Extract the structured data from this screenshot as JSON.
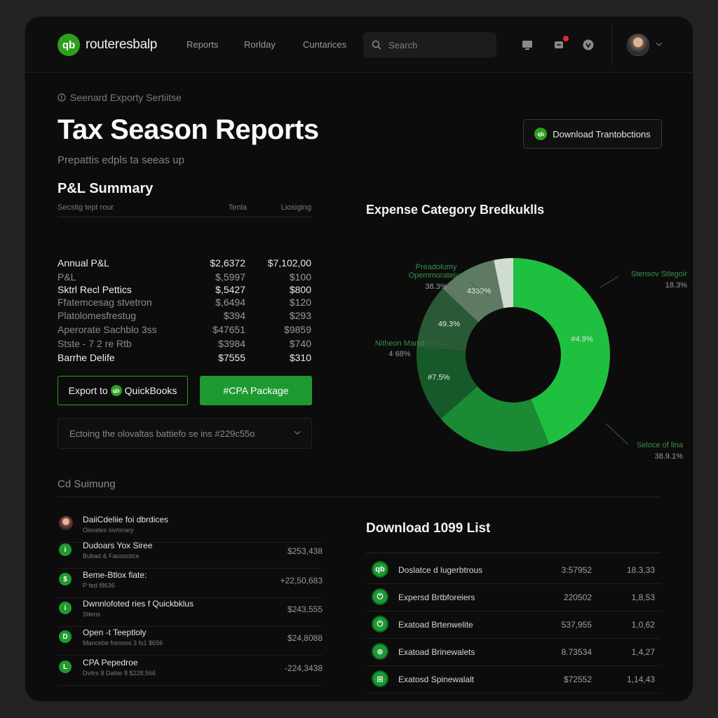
{
  "app": {
    "logo_text": "routeresbalp",
    "logo_mark": "qb",
    "nav": [
      "Reports",
      "Rorlday",
      "Cuntarices"
    ],
    "search_placeholder": "Search"
  },
  "header": {
    "breadcrumb": "Seenard Exporty Sertiitse",
    "title": "Tax Season Reports",
    "subtitle": "Prepattis edpls ta seeas up",
    "download_button": "Download Trantobctions"
  },
  "pl": {
    "title": "P&L Summary",
    "columns": [
      "Secstig tept rour",
      "Tenla",
      "Liosiging"
    ],
    "rows": [
      {
        "label": "Annual P&L",
        "v1": "$2,6372",
        "v2": "$7,102,00",
        "strong": true
      },
      {
        "label": "P&L",
        "v1": "$,5997",
        "v2": "$100",
        "strong": false
      },
      {
        "label": "Sktrl Recl Pettics",
        "v1": "$,5427",
        "v2": "$800",
        "strong": true
      },
      {
        "label": "Ffatemcesag stvetron",
        "v1": "$,6494",
        "v2": "$120",
        "strong": false
      },
      {
        "label": "Platolomesfrestug",
        "v1": "$394",
        "v2": "$293",
        "strong": false
      },
      {
        "label": "Aperorate Sachblo 3ss",
        "v1": "$47651",
        "v2": "$9859",
        "strong": false
      },
      {
        "label": "Stste - 7 2 re Rtb",
        "v1": "$3984",
        "v2": "$740",
        "strong": false
      },
      {
        "label": "Barrhe Delife",
        "v1": "$7555",
        "v2": "$310",
        "strong": true
      }
    ],
    "export_label": "Export to",
    "export_brand": "QuickBooks",
    "cpa_label": "#CPA Package",
    "dropdown_text": "Ectoing the olovaltas battiefo se ins #229c55o"
  },
  "chart_data": {
    "type": "pie",
    "title": "Expense Category Bredkuklls",
    "donut": true,
    "slices": [
      {
        "label": "",
        "value": 44.9,
        "pct_text": "#4.9%",
        "color": "#1fbf40"
      },
      {
        "label": "",
        "value": 20.0,
        "pct_text": "",
        "color": "#1b8a35"
      },
      {
        "label": "",
        "value": 13.0,
        "pct_text": "#7.5%",
        "color": "#175a2a"
      },
      {
        "label": "",
        "value": 11.0,
        "pct_text": "49.3%",
        "color": "#2a5a35"
      },
      {
        "label": "",
        "value": 10.0,
        "pct_text": "4339%",
        "color": "#5e7a62"
      },
      {
        "label": "",
        "value": 3.3,
        "pct_text": "",
        "color": "#d0dccf"
      }
    ],
    "callouts": [
      {
        "name": "Preadolumy",
        "sub": "Opemmorateiue",
        "pct": "38.3%"
      },
      {
        "name": "Stensov Stlegoir",
        "sub": "",
        "pct": "18.3%"
      },
      {
        "name": "Nitheon Mansl",
        "sub": "",
        "pct": "4 68%"
      },
      {
        "name": "Seloce of lina",
        "sub": "",
        "pct": "38.9.1%"
      }
    ]
  },
  "ca": {
    "title": "Cd Suimung",
    "items": [
      {
        "name": "DaiiCdeliie foi dbrdices",
        "sub": "Oiorates sivmnary",
        "amount": "",
        "icon": "avatar"
      },
      {
        "name": "Dudoars Yox Siree",
        "sub": "Bubad & Facooctice",
        "amount": "$253,438",
        "icon": "i"
      },
      {
        "name": "Beme-Btlox fiate:",
        "sub": "P fed f8636",
        "amount": "+22,50,683",
        "icon": "$"
      },
      {
        "name": "Dwnnlofoted ries f Quickbklus",
        "sub": "Stiens",
        "amount": "$243,555",
        "icon": "i"
      },
      {
        "name": "Open -t Teeptloly",
        "sub": "Mancebe freooos 3 fs1 $656",
        "amount": "$24,8088",
        "icon": "D"
      },
      {
        "name": "CPA Pepedroe",
        "sub": "Dvitrs 8 Dabie 8 $228,566",
        "amount": "-224,3438",
        "icon": "L"
      }
    ]
  },
  "list1099": {
    "title": "Download 1099 List",
    "rows": [
      {
        "name": "Doslatce d lugerbtrous",
        "v1": "3:57952",
        "v2": "18.3,33",
        "icon": "qb"
      },
      {
        "name": "Expersd Brtbforeiers",
        "v1": "220502",
        "v2": "1,8,53",
        "icon": "⏻"
      },
      {
        "name": "Exatoad Brtenwelite",
        "v1": "537,955",
        "v2": "1,0,62",
        "icon": "⏻"
      },
      {
        "name": "Exatoad Brinewalets",
        "v1": "8.73534",
        "v2": "1,4,27",
        "icon": "⊛"
      },
      {
        "name": "Exatosd Spinewalalt",
        "v1": "$72552",
        "v2": "1,14,43",
        "icon": "⊞"
      }
    ]
  }
}
